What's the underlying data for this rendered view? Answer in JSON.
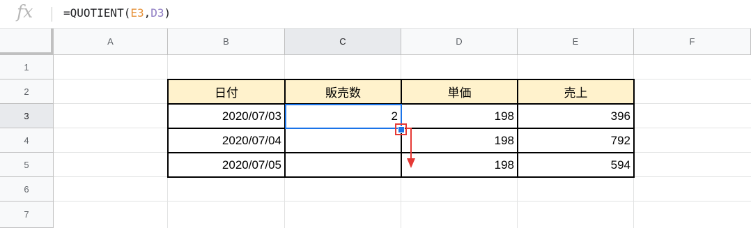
{
  "formula_bar": {
    "fx": "fx",
    "prefix": "=QUOTIENT(",
    "ref1": "E3",
    "comma": ",",
    "ref2": "D3",
    "suffix": ")"
  },
  "columns": [
    "A",
    "B",
    "C",
    "D",
    "E",
    "F"
  ],
  "rows": [
    "1",
    "2",
    "3",
    "4",
    "5",
    "6",
    "7"
  ],
  "selected_cell": "C3",
  "table": {
    "headers": [
      "日付",
      "販売数",
      "単価",
      "売上"
    ],
    "rows": [
      [
        "2020/07/03",
        "2",
        "198",
        "396"
      ],
      [
        "2020/07/04",
        "",
        "198",
        "792"
      ],
      [
        "2020/07/05",
        "",
        "198",
        "594"
      ]
    ]
  },
  "colors": {
    "header_fill": "#fff2cc",
    "selection": "#1a73e8",
    "annotation": "#e53935",
    "ref1": "#e69138",
    "ref2": "#8e7cc3"
  },
  "annotation": "fill-handle drag down arrow"
}
